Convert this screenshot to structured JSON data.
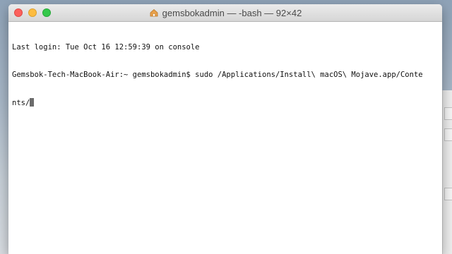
{
  "window": {
    "title": "gemsbokadmin — -bash — 92×42"
  },
  "terminal": {
    "lines": [
      "Last login: Tue Oct 16 12:59:39 on console",
      "Gemsbok-Tech-MacBook-Air:~ gemsbokadmin$ sudo /Applications/Install\\ macOS\\ Mojave.app/Conte",
      "nts/"
    ]
  },
  "colors": {
    "close": "#fc605c",
    "minimize": "#fdbc40",
    "zoom": "#34c84a"
  }
}
